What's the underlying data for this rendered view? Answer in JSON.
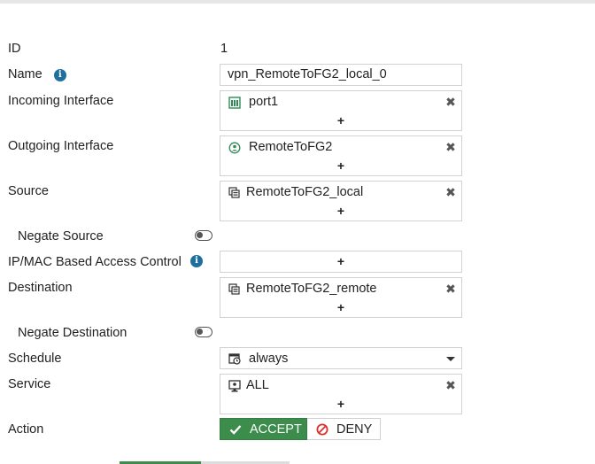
{
  "form": {
    "id": {
      "label": "ID",
      "value": "1"
    },
    "name": {
      "label": "Name",
      "value": "vpn_RemoteToFG2_local_0",
      "info_icon": "info-icon"
    },
    "incoming_interface": {
      "label": "Incoming Interface",
      "entries": [
        "port1"
      ],
      "entry_icon": "port-icon"
    },
    "outgoing_interface": {
      "label": "Outgoing Interface",
      "entries": [
        "RemoteToFG2"
      ],
      "entry_icon": "vpn-tunnel-icon"
    },
    "source": {
      "label": "Source",
      "entries": [
        "RemoteToFG2_local"
      ],
      "entry_icon": "address-object-icon"
    },
    "negate_source": {
      "label": "Negate Source",
      "enabled": false
    },
    "ip_mac_access": {
      "label": "IP/MAC Based Access Control",
      "info_icon": "info-icon"
    },
    "destination": {
      "label": "Destination",
      "entries": [
        "RemoteToFG2_remote"
      ],
      "entry_icon": "address-object-icon"
    },
    "negate_destination": {
      "label": "Negate Destination",
      "enabled": false
    },
    "schedule": {
      "label": "Schedule",
      "value": "always",
      "icon": "schedule-icon"
    },
    "service": {
      "label": "Service",
      "entries": [
        "ALL"
      ],
      "entry_icon": "service-icon"
    },
    "action": {
      "label": "Action",
      "accept_label": "ACCEPT",
      "deny_label": "DENY",
      "selected": "ACCEPT"
    }
  },
  "controls": {
    "add_symbol": "+",
    "remove_symbol": "✖"
  },
  "colors": {
    "accent_green": "#3c8c4b",
    "info_blue": "#1f6f9e",
    "deny_red": "#d9302c",
    "icon_green": "#2e8b57"
  }
}
